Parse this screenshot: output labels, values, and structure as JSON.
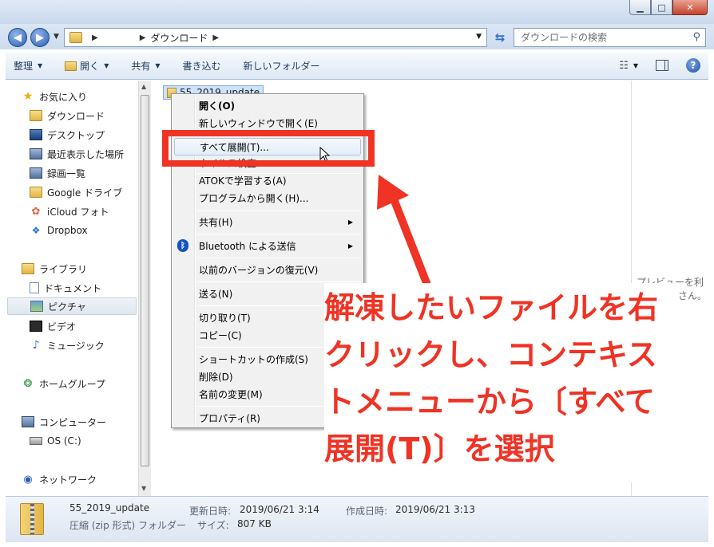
{
  "window": {
    "minimize_label": "▁",
    "maximize_label": "□",
    "close_label": "✕"
  },
  "address": {
    "crumb_current": "ダウンロード",
    "search_placeholder": "ダウンロードの検索"
  },
  "toolbar": {
    "organize": "整理",
    "open": "開く",
    "share": "共有",
    "burn": "書き込む",
    "new_folder": "新しいフォルダー"
  },
  "sidebar": {
    "favorites": "お気に入り",
    "downloads": "ダウンロード",
    "desktop": "デスクトップ",
    "recent": "最近表示した場所",
    "recorded": "録画一覧",
    "google_drive": "Google ドライブ",
    "icloud": "iCloud フォト",
    "dropbox": "Dropbox",
    "libraries": "ライブラリ",
    "documents": "ドキュメント",
    "pictures": "ピクチャ",
    "videos": "ビデオ",
    "music": "ミュージック",
    "homegroup": "ホームグループ",
    "computer": "コンピューター",
    "os_drive": "OS (C:)",
    "network": "ネットワーク"
  },
  "content": {
    "selected_file": "55_2019_update"
  },
  "preview": {
    "text_line1": "プレビューを利",
    "text_line2": "さん。"
  },
  "context_menu": {
    "open": "開く(O)",
    "open_new_window": "新しいウィンドウで開く(E)",
    "extract_all": "すべて展開(T)...",
    "virus_scan": "ウイルス検査",
    "atok": "ATOKで学習する(A)",
    "open_with": "プログラムから開く(H)...",
    "share": "共有(H)",
    "bluetooth": "Bluetooth による送信",
    "restore_versions": "以前のバージョンの復元(V)",
    "send_to": "送る(N)",
    "cut": "切り取り(T)",
    "copy": "コピー(C)",
    "create_shortcut": "ショートカットの作成(S)",
    "delete": "削除(D)",
    "rename": "名前の変更(M)",
    "properties": "プロパティ(R)"
  },
  "status": {
    "filename": "55_2019_update",
    "type": "圧縮 (zip 形式) フォルダー",
    "modified_label": "更新日時:",
    "modified_value": "2019/06/21 3:14",
    "created_label": "作成日時:",
    "created_value": "2019/06/21 3:13",
    "size_label": "サイズ:",
    "size_value": "807 KB"
  },
  "annotation": {
    "line1": "解凍したいファイルを右",
    "line2": "クリックし、コンテキス",
    "line3": "トメニューから〔すべて",
    "line4": "展開(T)〕を選択"
  },
  "colors": {
    "annotation_red": "#ef3324",
    "selection_blue": "#cce3fa",
    "chrome_blue": "#cddcee"
  }
}
